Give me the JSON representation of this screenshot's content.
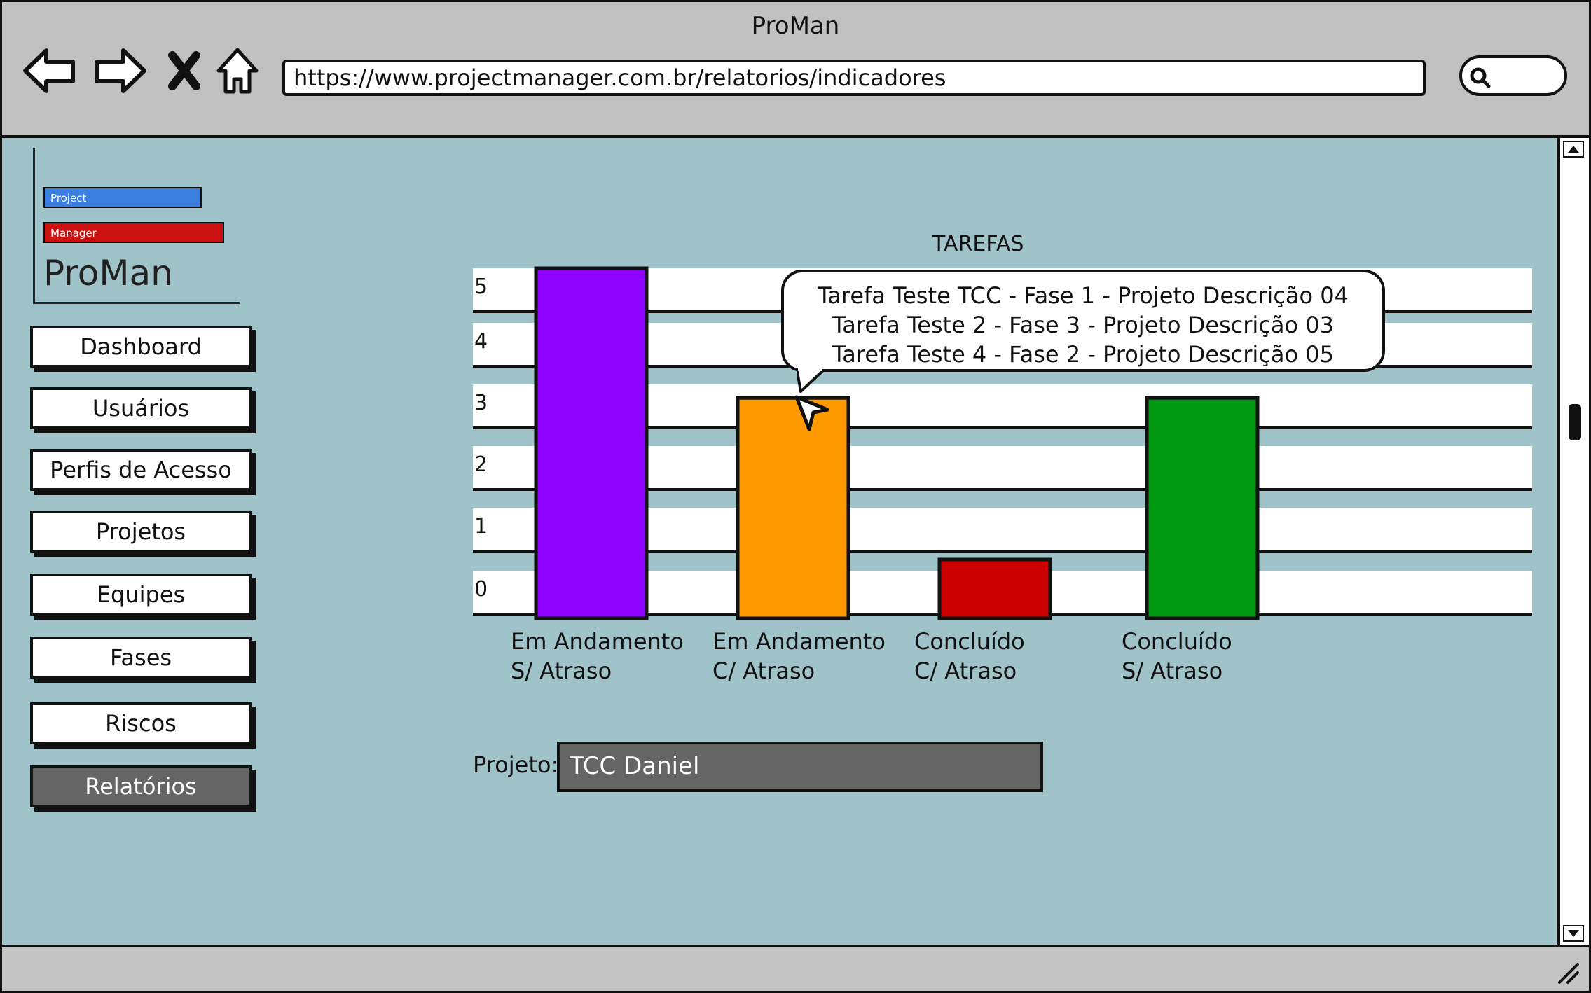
{
  "window": {
    "title": "ProMan"
  },
  "browser": {
    "url": "https://www.projectmanager.com.br/relatorios/indicadores",
    "icons": [
      "back-arrow-icon",
      "forward-arrow-icon",
      "close-x-icon",
      "home-icon",
      "search-icon"
    ]
  },
  "logo": {
    "line1": "Project",
    "line2": "Manager",
    "name": "ProMan"
  },
  "sidebar": {
    "items": [
      {
        "label": "Dashboard"
      },
      {
        "label": "Usuários"
      },
      {
        "label": "Perfis de Acesso"
      },
      {
        "label": "Projetos"
      },
      {
        "label": "Equipes"
      },
      {
        "label": "Fases"
      },
      {
        "label": "Riscos"
      },
      {
        "label": "Relatórios",
        "active": true
      }
    ]
  },
  "chart_data": {
    "type": "bar",
    "title": "TAREFAS",
    "categories": [
      [
        "Em Andamento",
        "S/ Atraso"
      ],
      [
        "Em Andamento",
        "C/ Atraso"
      ],
      [
        "Concluído",
        "C/ Atraso"
      ],
      [
        "Concluído",
        "S/ Atraso"
      ]
    ],
    "values": [
      5,
      3,
      0,
      3
    ],
    "colors": [
      "#8e00ff",
      "#ff9900",
      "#cc0000",
      "#009911"
    ],
    "ylim": [
      0,
      5
    ],
    "yticks": [
      "5",
      "4",
      "3",
      "2",
      "1",
      "0"
    ],
    "grid": true
  },
  "tooltip": {
    "lines": [
      "Tarefa Teste TCC - Fase 1 - Projeto Descrição 04",
      "Tarefa Teste 2 - Fase 3 - Projeto Descrição 03",
      "Tarefa Teste 4 - Fase 2 - Projeto Descrição 05"
    ]
  },
  "project_filter": {
    "label": "Projeto:",
    "value": "TCC Daniel"
  }
}
